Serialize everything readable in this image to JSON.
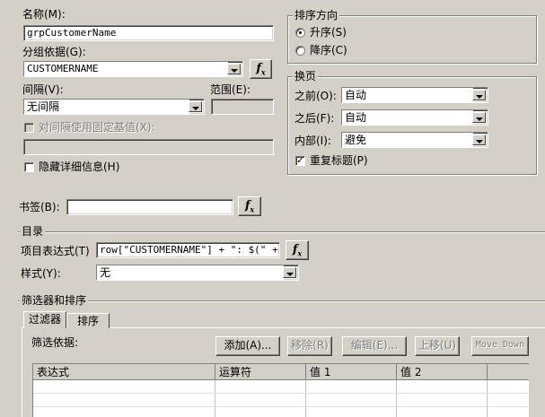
{
  "name": {
    "label": "名称(M):",
    "value": "grpCustomerName"
  },
  "group_by": {
    "label": "分组依据(G):",
    "value": "CUSTOMERNAME"
  },
  "interval": {
    "label": "间隔(V):",
    "value": "无间隔"
  },
  "range": {
    "label": "范围(E):",
    "value": ""
  },
  "fixed_base": {
    "label": "对间隔使用固定基值(X):",
    "value": ""
  },
  "hide_detail": {
    "label": "隐藏详细信息(H)"
  },
  "sort_direction": {
    "title": "排序方向",
    "asc_label": "升序(S)",
    "desc_label": "降序(C)",
    "selected": "asc"
  },
  "page_break": {
    "title": "换页",
    "before_label": "之前(O):",
    "before_value": "自动",
    "after_label": "之后(F):",
    "after_value": "自动",
    "inside_label": "内部(I):",
    "inside_value": "避免",
    "repeat_header_label": "重复标题(P)",
    "repeat_header_checked": true
  },
  "bookmark": {
    "label": "书签(B):",
    "value": ""
  },
  "toc": {
    "title": "目录",
    "item_expr_label": "项目表达式(T)",
    "item_expr_value": "row[\"CUSTOMERNAME\"] + \": $(\" + row",
    "style_label": "样式(Y):",
    "style_value": "无"
  },
  "filter_sort": {
    "title": "筛选器和排序",
    "tabs": [
      "过滤器",
      "排序"
    ],
    "filter_on_label": "筛选依据:",
    "buttons": {
      "add": "添加(A)...",
      "remove": "移除(R)",
      "edit": "编辑(E)...",
      "move_up": "上移(U)",
      "move_down": "Move Down"
    },
    "columns": [
      "表达式",
      "运算符",
      "值 1",
      "值 2"
    ]
  },
  "icons": {
    "fx": "function-builder-icon"
  }
}
